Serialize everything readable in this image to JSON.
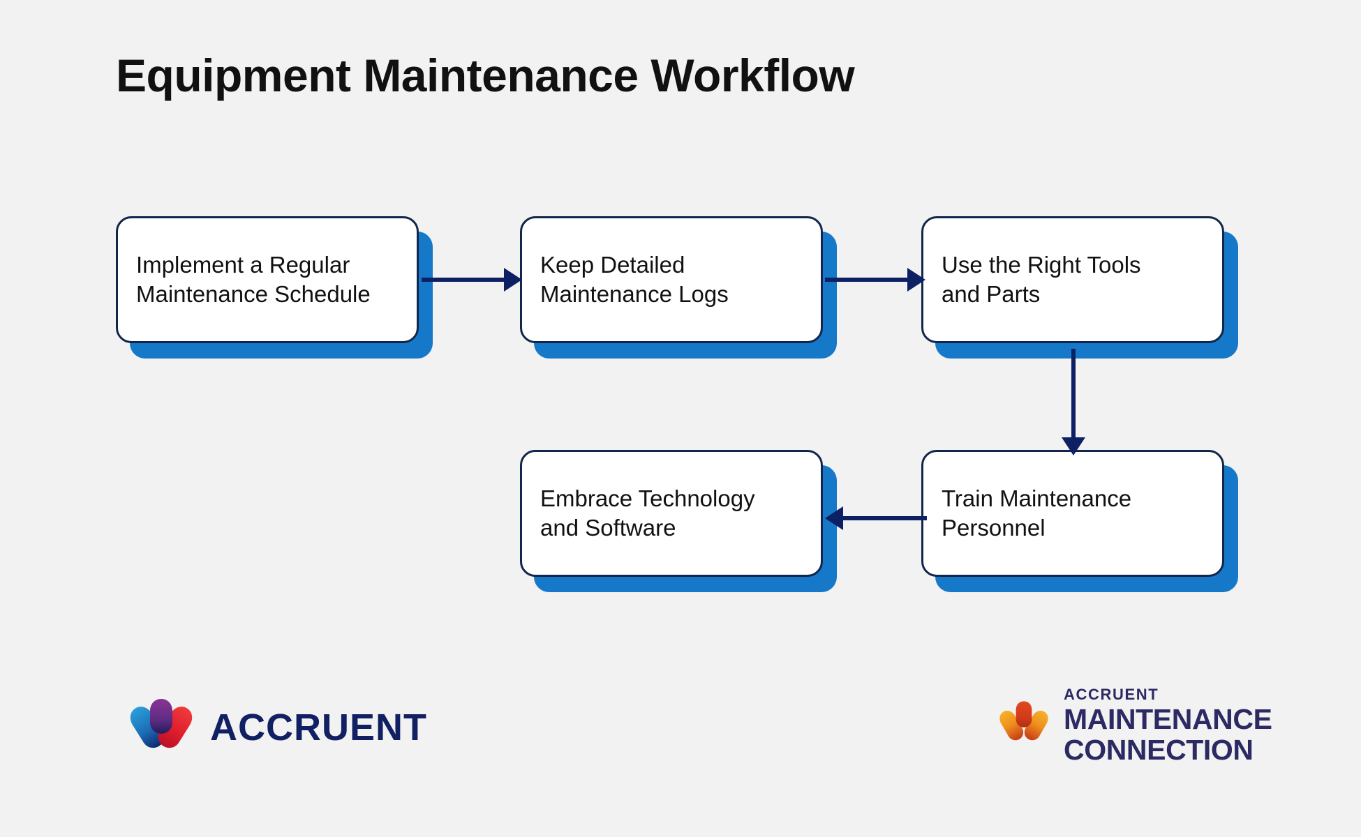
{
  "page": {
    "title": "Equipment Maintenance Workflow",
    "background_color": "#f2f2f2"
  },
  "colors": {
    "card_background": "#ffffff",
    "card_border": "#12254b",
    "card_shadow": "#1678c8",
    "connector": "#0d2063",
    "title_text": "#111111",
    "accruent_wordmark": "#111f63",
    "mc_wordmark": "#2b2a63"
  },
  "chart_data": {
    "type": "diagram",
    "title": "Equipment Maintenance Workflow",
    "nodes": [
      {
        "id": "n1",
        "label": "Implement a Regular Maintenance Schedule",
        "row": 1,
        "col": 1
      },
      {
        "id": "n2",
        "label": "Keep Detailed Maintenance Logs",
        "row": 1,
        "col": 2
      },
      {
        "id": "n3",
        "label": "Use the Right Tools and Parts",
        "row": 1,
        "col": 3
      },
      {
        "id": "n4",
        "label": "Train Maintenance Personnel",
        "row": 2,
        "col": 3
      },
      {
        "id": "n5",
        "label": "Embrace Technology and Software",
        "row": 2,
        "col": 2
      }
    ],
    "edges": [
      {
        "from": "n1",
        "to": "n2",
        "direction": "right"
      },
      {
        "from": "n2",
        "to": "n3",
        "direction": "right"
      },
      {
        "from": "n3",
        "to": "n4",
        "direction": "down"
      },
      {
        "from": "n4",
        "to": "n5",
        "direction": "left"
      }
    ]
  },
  "nodes": {
    "node1": {
      "line1": "Implement a Regular",
      "line2": "Maintenance Schedule"
    },
    "node2": {
      "line1": "Keep Detailed",
      "line2": "Maintenance Logs"
    },
    "node3": {
      "line1": "Use the Right Tools",
      "line2": "and Parts"
    },
    "node4": {
      "line1": "Train Maintenance",
      "line2": "Personnel"
    },
    "node5": {
      "line1": "Embrace Technology",
      "line2": "and Software"
    }
  },
  "logos": {
    "accruent": {
      "wordmark": "ACCRUENT",
      "mark_colors": {
        "left": "#1f8fd0",
        "top": "#7b2f8f",
        "right": "#e8222e",
        "base": "#10286e"
      }
    },
    "maintenance_connection": {
      "eyebrow": "ACCRUENT",
      "line1": "MAINTENANCE",
      "line2": "CONNECTION",
      "mark_colors": {
        "left": "#f0a31e",
        "top": "#d43b18",
        "right": "#f0a31e",
        "base": "#c63a1b"
      }
    }
  }
}
